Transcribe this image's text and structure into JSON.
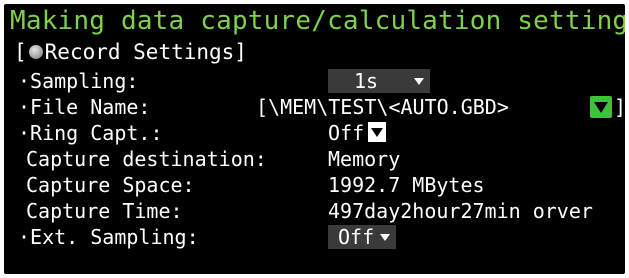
{
  "title": "Making data capture/calculation settings",
  "section": {
    "open_bracket": "[",
    "label": "Record Settings]",
    "icon": "record-dot-icon"
  },
  "rows": {
    "sampling": {
      "label": "·Sampling:",
      "value": "1s"
    },
    "file_name": {
      "label": "·File Name:",
      "value": "[\\MEM\\TEST\\<AUTO.GBD>",
      "close_bracket": "]"
    },
    "ring_capt": {
      "label": "·Ring Capt.:",
      "value": "Off"
    },
    "capture_destination": {
      "label": "Capture destination:",
      "value": "Memory"
    },
    "capture_space": {
      "label": "Capture Space:",
      "value": "1992.7 MBytes"
    },
    "capture_time": {
      "label": "Capture Time:",
      "value": "497day2hour27min orver"
    },
    "ext_sampling": {
      "label": "·Ext. Sampling:",
      "value": "Off"
    }
  },
  "colors": {
    "background": "#000000",
    "title": "#7fd04a",
    "text": "#ffffff",
    "dropdown_box": "#3a3a3a",
    "file_button": "#3ec23e"
  },
  "icons": {
    "dropdown": "triangle-down-icon",
    "file_select": "green-triangle-button-icon"
  }
}
